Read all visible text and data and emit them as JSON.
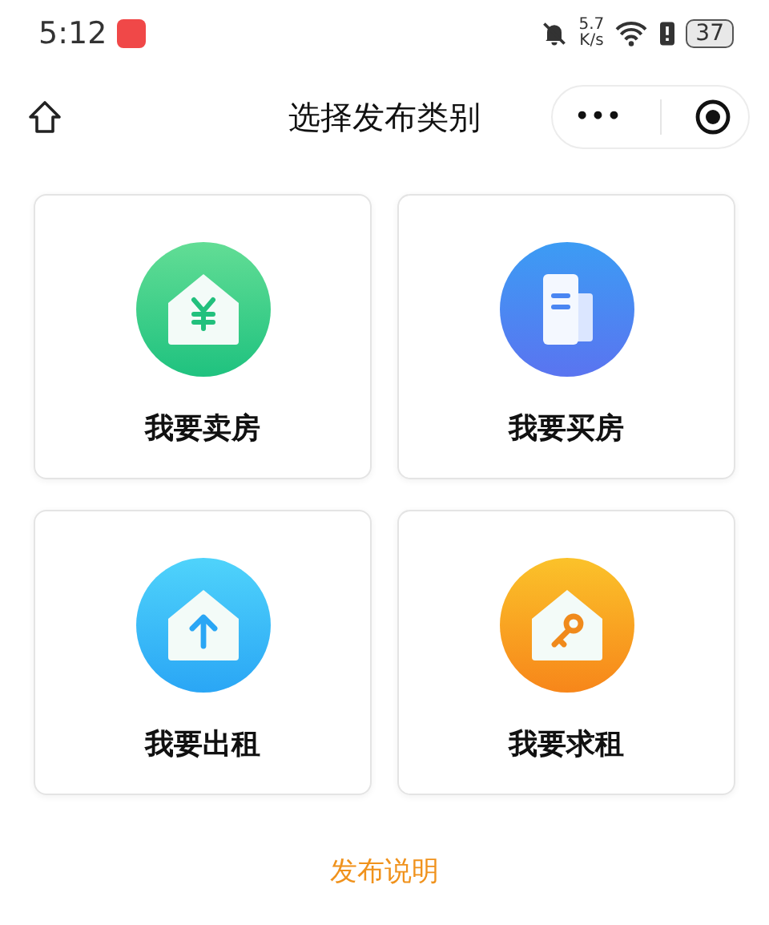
{
  "status_bar": {
    "time": "5:12",
    "speed_value": "5.7",
    "speed_unit": "K/s",
    "battery": "37"
  },
  "nav": {
    "title": "选择发布类别",
    "menu_glyph": "•••"
  },
  "categories": [
    {
      "label": "我要卖房",
      "kind": "sell"
    },
    {
      "label": "我要买房",
      "kind": "buy"
    },
    {
      "label": "我要出租",
      "kind": "rent_out"
    },
    {
      "label": "我要求租",
      "kind": "rent_in"
    }
  ],
  "footer_link": "发布说明"
}
